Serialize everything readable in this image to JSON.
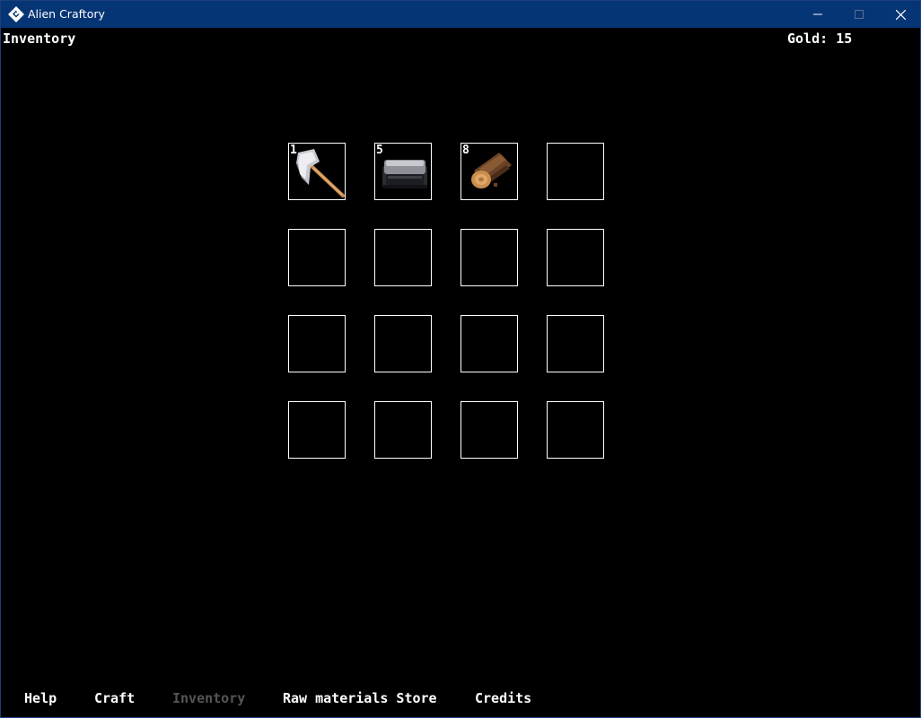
{
  "window": {
    "title": "Alien Craftory"
  },
  "game": {
    "screen_title": "Inventory",
    "gold_label": "Gold:",
    "gold_value": "15",
    "slots": [
      {
        "item": "axe-icon",
        "qty": "1"
      },
      {
        "item": "anvil-icon",
        "qty": "5"
      },
      {
        "item": "log-icon",
        "qty": "8"
      },
      {
        "item": null,
        "qty": ""
      },
      {
        "item": null,
        "qty": ""
      },
      {
        "item": null,
        "qty": ""
      },
      {
        "item": null,
        "qty": ""
      },
      {
        "item": null,
        "qty": ""
      },
      {
        "item": null,
        "qty": ""
      },
      {
        "item": null,
        "qty": ""
      },
      {
        "item": null,
        "qty": ""
      },
      {
        "item": null,
        "qty": ""
      },
      {
        "item": null,
        "qty": ""
      },
      {
        "item": null,
        "qty": ""
      },
      {
        "item": null,
        "qty": ""
      },
      {
        "item": null,
        "qty": ""
      }
    ]
  },
  "nav": {
    "items": [
      {
        "label": "Help"
      },
      {
        "label": "Craft"
      },
      {
        "label": "Inventory",
        "active": true
      },
      {
        "label": "Raw materials Store"
      },
      {
        "label": "Credits"
      }
    ]
  },
  "colors": {
    "titlebar": "#063575",
    "background": "#000000",
    "text": "#ffffff",
    "nav_active": "#555555",
    "slot_border": "#ffffff"
  }
}
